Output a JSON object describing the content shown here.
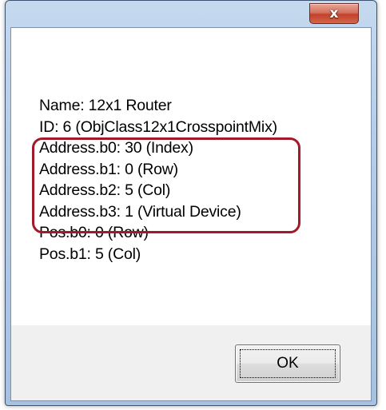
{
  "window": {
    "close_icon_glyph": "x"
  },
  "info": {
    "lines": [
      "Name: 12x1 Router",
      "ID: 6 (ObjClass12x1CrosspointMix)",
      "Address.b0: 30 (Index)",
      "Address.b1: 0 (Row)",
      "Address.b2: 5 (Col)",
      "Address.b3: 1 (Virtual Device)",
      "Pos.b0: 0 (Row)",
      "Pos.b1: 5 (Col)"
    ]
  },
  "buttons": {
    "ok_label": "OK"
  },
  "colors": {
    "highlight_border": "#a3192a",
    "close_button": "#c3412a",
    "frame": "#b4cde8"
  }
}
